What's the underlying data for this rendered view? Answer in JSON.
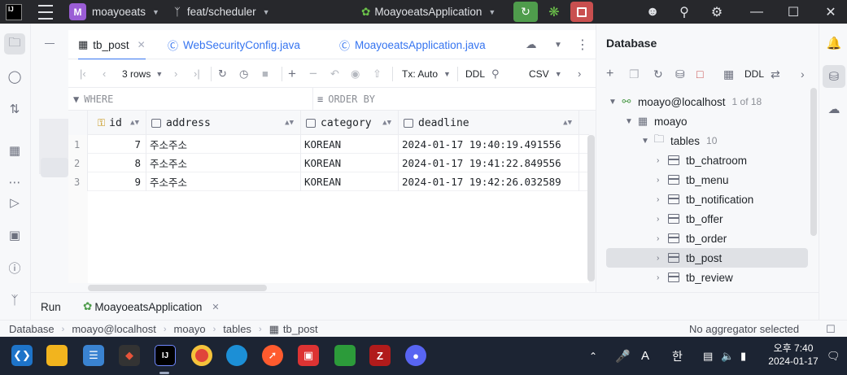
{
  "titlebar": {
    "logo": "IJ",
    "project_badge": "M",
    "project_name": "moayoeats",
    "branch": "feat/scheduler",
    "run_config": "MoayoeatsApplication"
  },
  "tabs": [
    {
      "label": "tb_post",
      "icon": "table-icon",
      "active": true
    },
    {
      "label": "WebSecurityConfig.java",
      "icon": "class-icon",
      "active": false
    },
    {
      "label": "MoayoeatsApplication.java",
      "icon": "spring-class-icon",
      "active": false
    }
  ],
  "grid_toolbar": {
    "rows_label": "3 rows",
    "tx_label": "Tx: Auto",
    "ddl_label": "DDL",
    "export_label": "CSV"
  },
  "filter": {
    "where_placeholder": "WHERE",
    "orderby_placeholder": "ORDER BY"
  },
  "grid": {
    "columns": [
      "id",
      "address",
      "category",
      "deadline"
    ],
    "rows": [
      {
        "n": "1",
        "id": "7",
        "address": "주소주소",
        "category": "KOREAN",
        "deadline": "2024-01-17 19:40:19.491556"
      },
      {
        "n": "2",
        "id": "8",
        "address": "주소주소",
        "category": "KOREAN",
        "deadline": "2024-01-17 19:41:22.849556"
      },
      {
        "n": "3",
        "id": "9",
        "address": "주소주소",
        "category": "KOREAN",
        "deadline": "2024-01-17 19:42:26.032589"
      }
    ]
  },
  "database": {
    "title": "Database",
    "ddl_label": "DDL",
    "connection": "moayo@localhost",
    "connection_count": "1 of 18",
    "schema": "moayo",
    "tables_label": "tables",
    "tables_count": "10",
    "tables": [
      "tb_chatroom",
      "tb_menu",
      "tb_notification",
      "tb_offer",
      "tb_order",
      "tb_post",
      "tb_review"
    ],
    "selected_table": "tb_post"
  },
  "runbar": {
    "run_label": "Run",
    "config_label": "MoayoeatsApplication"
  },
  "statusbar": {
    "breadcrumb": [
      "Database",
      "moayo@localhost",
      "moayo",
      "tables",
      "tb_post"
    ],
    "right_text": "No aggregator selected"
  },
  "taskbar": {
    "ime_letter": "A",
    "ime_lang": "한",
    "time": "오후 7:40",
    "date": "2024-01-17"
  },
  "colors": {
    "accent": "#3574f0",
    "run_green": "#4f9c4c",
    "stop_red": "#c94f4f",
    "project_purple": "#9a5dd5",
    "titlebar": "#27282c",
    "taskbar": "#1c2433"
  }
}
